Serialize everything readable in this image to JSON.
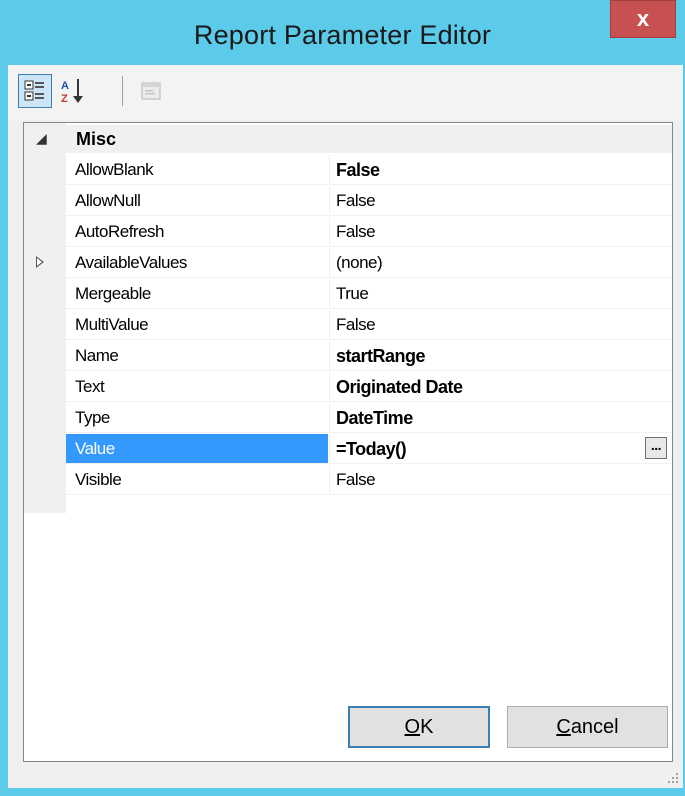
{
  "window": {
    "title": "Report Parameter Editor",
    "close_label": "x",
    "colors": {
      "frame": "#5ccbea",
      "close": "#c75050",
      "selection": "#3399ff"
    }
  },
  "toolbar": {
    "categorized_icon": "categorized-view-icon",
    "alphabetical_icon": "sort-az-icon",
    "property_pages_icon": "property-pages-icon"
  },
  "grid": {
    "category": {
      "label": "Misc",
      "toggle": "◢"
    },
    "properties": [
      {
        "name": "AllowBlank",
        "value": "False",
        "bold": true
      },
      {
        "name": "AllowNull",
        "value": "False",
        "bold": false
      },
      {
        "name": "AutoRefresh",
        "value": "False",
        "bold": false
      },
      {
        "name": "AvailableValues",
        "value": "(none)",
        "bold": false,
        "expandable": true
      },
      {
        "name": "Mergeable",
        "value": "True",
        "bold": false
      },
      {
        "name": "MultiValue",
        "value": "False",
        "bold": false
      },
      {
        "name": "Name",
        "value": "startRange",
        "bold": true
      },
      {
        "name": "Text",
        "value": "Originated Date",
        "bold": true
      },
      {
        "name": "Type",
        "value": "DateTime",
        "bold": true
      },
      {
        "name": "Value",
        "value": "=Today()",
        "bold": true,
        "selected": true,
        "ellipsis": "..."
      },
      {
        "name": "Visible",
        "value": "False",
        "bold": false
      }
    ]
  },
  "buttons": {
    "ok_prefix": "O",
    "ok_rest": "K",
    "cancel_prefix": "C",
    "cancel_rest": "ancel"
  }
}
